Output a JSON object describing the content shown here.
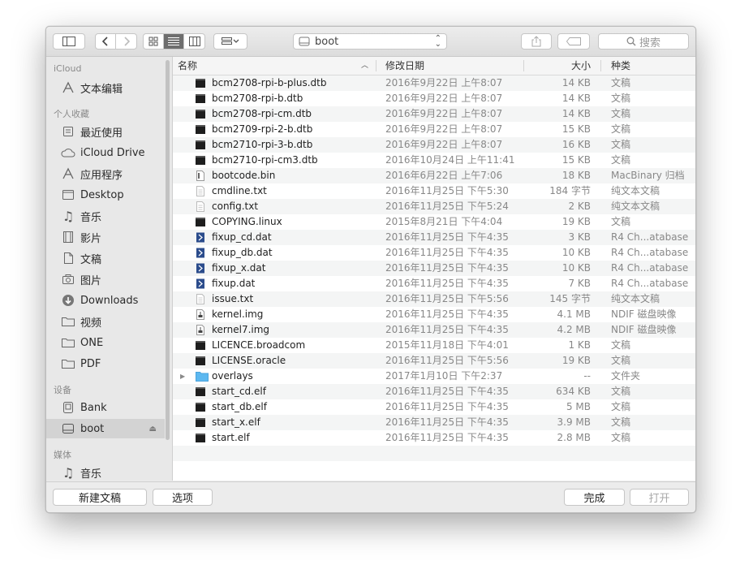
{
  "toolbar": {
    "path_label": "boot",
    "search_placeholder": "搜索"
  },
  "sidebar": {
    "sections": [
      {
        "title": "iCloud"
      },
      {
        "title": "个人收藏"
      },
      {
        "title": "设备"
      },
      {
        "title": "媒体"
      }
    ],
    "items": [
      {
        "label": "文本编辑",
        "icon": "textedit-icon"
      },
      {
        "label": "最近使用",
        "icon": "recents-icon"
      },
      {
        "label": "iCloud Drive",
        "icon": "cloud-icon"
      },
      {
        "label": "应用程序",
        "icon": "applications-icon"
      },
      {
        "label": "Desktop",
        "icon": "desktop-icon"
      },
      {
        "label": "音乐",
        "icon": "music-icon"
      },
      {
        "label": "影片",
        "icon": "movies-icon"
      },
      {
        "label": "文稿",
        "icon": "documents-icon"
      },
      {
        "label": "图片",
        "icon": "pictures-icon"
      },
      {
        "label": "Downloads",
        "icon": "downloads-icon"
      },
      {
        "label": "视频",
        "icon": "folder-icon"
      },
      {
        "label": "ONE",
        "icon": "folder-icon"
      },
      {
        "label": "PDF",
        "icon": "folder-icon"
      },
      {
        "label": "Bank",
        "icon": "disk-icon"
      },
      {
        "label": "boot",
        "icon": "disk-icon",
        "selected": true
      },
      {
        "label": "音乐",
        "icon": "music-icon"
      }
    ]
  },
  "columns": {
    "name": "名称",
    "date": "修改日期",
    "size": "大小",
    "kind": "种类"
  },
  "files": [
    {
      "name": "bcm2708-rpi-b-plus.dtb",
      "date": "2016年9月22日 上午8:07",
      "size": "14 KB",
      "kind": "文稿",
      "icon": "exec"
    },
    {
      "name": "bcm2708-rpi-b.dtb",
      "date": "2016年9月22日 上午8:07",
      "size": "14 KB",
      "kind": "文稿",
      "icon": "exec"
    },
    {
      "name": "bcm2708-rpi-cm.dtb",
      "date": "2016年9月22日 上午8:07",
      "size": "14 KB",
      "kind": "文稿",
      "icon": "exec"
    },
    {
      "name": "bcm2709-rpi-2-b.dtb",
      "date": "2016年9月22日 上午8:07",
      "size": "15 KB",
      "kind": "文稿",
      "icon": "exec"
    },
    {
      "name": "bcm2710-rpi-3-b.dtb",
      "date": "2016年9月22日 上午8:07",
      "size": "16 KB",
      "kind": "文稿",
      "icon": "exec"
    },
    {
      "name": "bcm2710-rpi-cm3.dtb",
      "date": "2016年10月24日 上午11:41",
      "size": "15 KB",
      "kind": "文稿",
      "icon": "exec"
    },
    {
      "name": "bootcode.bin",
      "date": "2016年6月22日 上午7:06",
      "size": "18 KB",
      "kind": "MacBinary 归档",
      "icon": "bin"
    },
    {
      "name": "cmdline.txt",
      "date": "2016年11月25日 下午5:30",
      "size": "184 字节",
      "kind": "纯文本文稿",
      "icon": "text"
    },
    {
      "name": "config.txt",
      "date": "2016年11月25日 下午5:24",
      "size": "2 KB",
      "kind": "纯文本文稿",
      "icon": "text"
    },
    {
      "name": "COPYING.linux",
      "date": "2015年8月21日 下午4:04",
      "size": "19 KB",
      "kind": "文稿",
      "icon": "exec"
    },
    {
      "name": "fixup_cd.dat",
      "date": "2016年11月25日 下午4:35",
      "size": "3 KB",
      "kind": "R4 Ch...atabase",
      "icon": "dat"
    },
    {
      "name": "fixup_db.dat",
      "date": "2016年11月25日 下午4:35",
      "size": "10 KB",
      "kind": "R4 Ch...atabase",
      "icon": "dat"
    },
    {
      "name": "fixup_x.dat",
      "date": "2016年11月25日 下午4:35",
      "size": "10 KB",
      "kind": "R4 Ch...atabase",
      "icon": "dat"
    },
    {
      "name": "fixup.dat",
      "date": "2016年11月25日 下午4:35",
      "size": "7 KB",
      "kind": "R4 Ch...atabase",
      "icon": "dat"
    },
    {
      "name": "issue.txt",
      "date": "2016年11月25日 下午5:56",
      "size": "145 字节",
      "kind": "纯文本文稿",
      "icon": "text"
    },
    {
      "name": "kernel.img",
      "date": "2016年11月25日 下午4:35",
      "size": "4.1 MB",
      "kind": "NDIF 磁盘映像",
      "icon": "img"
    },
    {
      "name": "kernel7.img",
      "date": "2016年11月25日 下午4:35",
      "size": "4.2 MB",
      "kind": "NDIF 磁盘映像",
      "icon": "img"
    },
    {
      "name": "LICENCE.broadcom",
      "date": "2015年11月18日 下午4:01",
      "size": "1 KB",
      "kind": "文稿",
      "icon": "exec"
    },
    {
      "name": "LICENSE.oracle",
      "date": "2016年11月25日 下午5:56",
      "size": "19 KB",
      "kind": "文稿",
      "icon": "exec"
    },
    {
      "name": "overlays",
      "date": "2017年1月10日 下午2:37",
      "size": "--",
      "kind": "文件夹",
      "icon": "folder"
    },
    {
      "name": "start_cd.elf",
      "date": "2016年11月25日 下午4:35",
      "size": "634 KB",
      "kind": "文稿",
      "icon": "exec"
    },
    {
      "name": "start_db.elf",
      "date": "2016年11月25日 下午4:35",
      "size": "5 MB",
      "kind": "文稿",
      "icon": "exec"
    },
    {
      "name": "start_x.elf",
      "date": "2016年11月25日 下午4:35",
      "size": "3.9 MB",
      "kind": "文稿",
      "icon": "exec"
    },
    {
      "name": "start.elf",
      "date": "2016年11月25日 下午4:35",
      "size": "2.8 MB",
      "kind": "文稿",
      "icon": "exec"
    }
  ],
  "bottom": {
    "new_doc": "新建文稿",
    "options": "选项",
    "done": "完成",
    "open": "打开"
  }
}
